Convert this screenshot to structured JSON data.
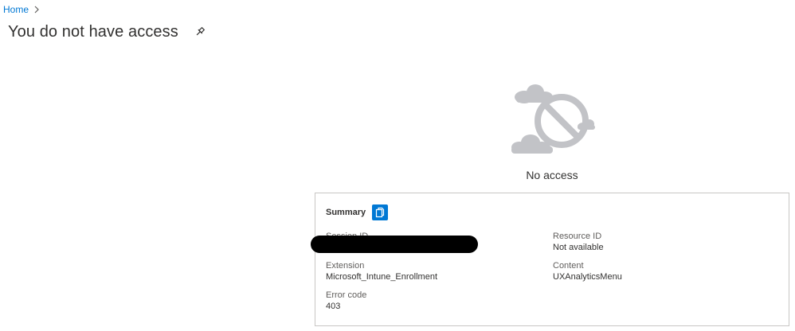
{
  "breadcrumb": {
    "home": "Home"
  },
  "page": {
    "title": "You do not have access"
  },
  "message": {
    "text": "No access"
  },
  "summary": {
    "title": "Summary",
    "session_id_label": "Session ID",
    "resource_id_label": "Resource ID",
    "resource_id_value": "Not available",
    "extension_label": "Extension",
    "extension_value": "Microsoft_Intune_Enrollment",
    "content_label": "Content",
    "content_value": "UXAnalyticsMenu",
    "error_code_label": "Error code",
    "error_code_value": "403"
  },
  "colors": {
    "link": "#0078d4",
    "accent": "#0078d4",
    "illustration": "#c2c3c7",
    "border": "#c8c6c4"
  }
}
